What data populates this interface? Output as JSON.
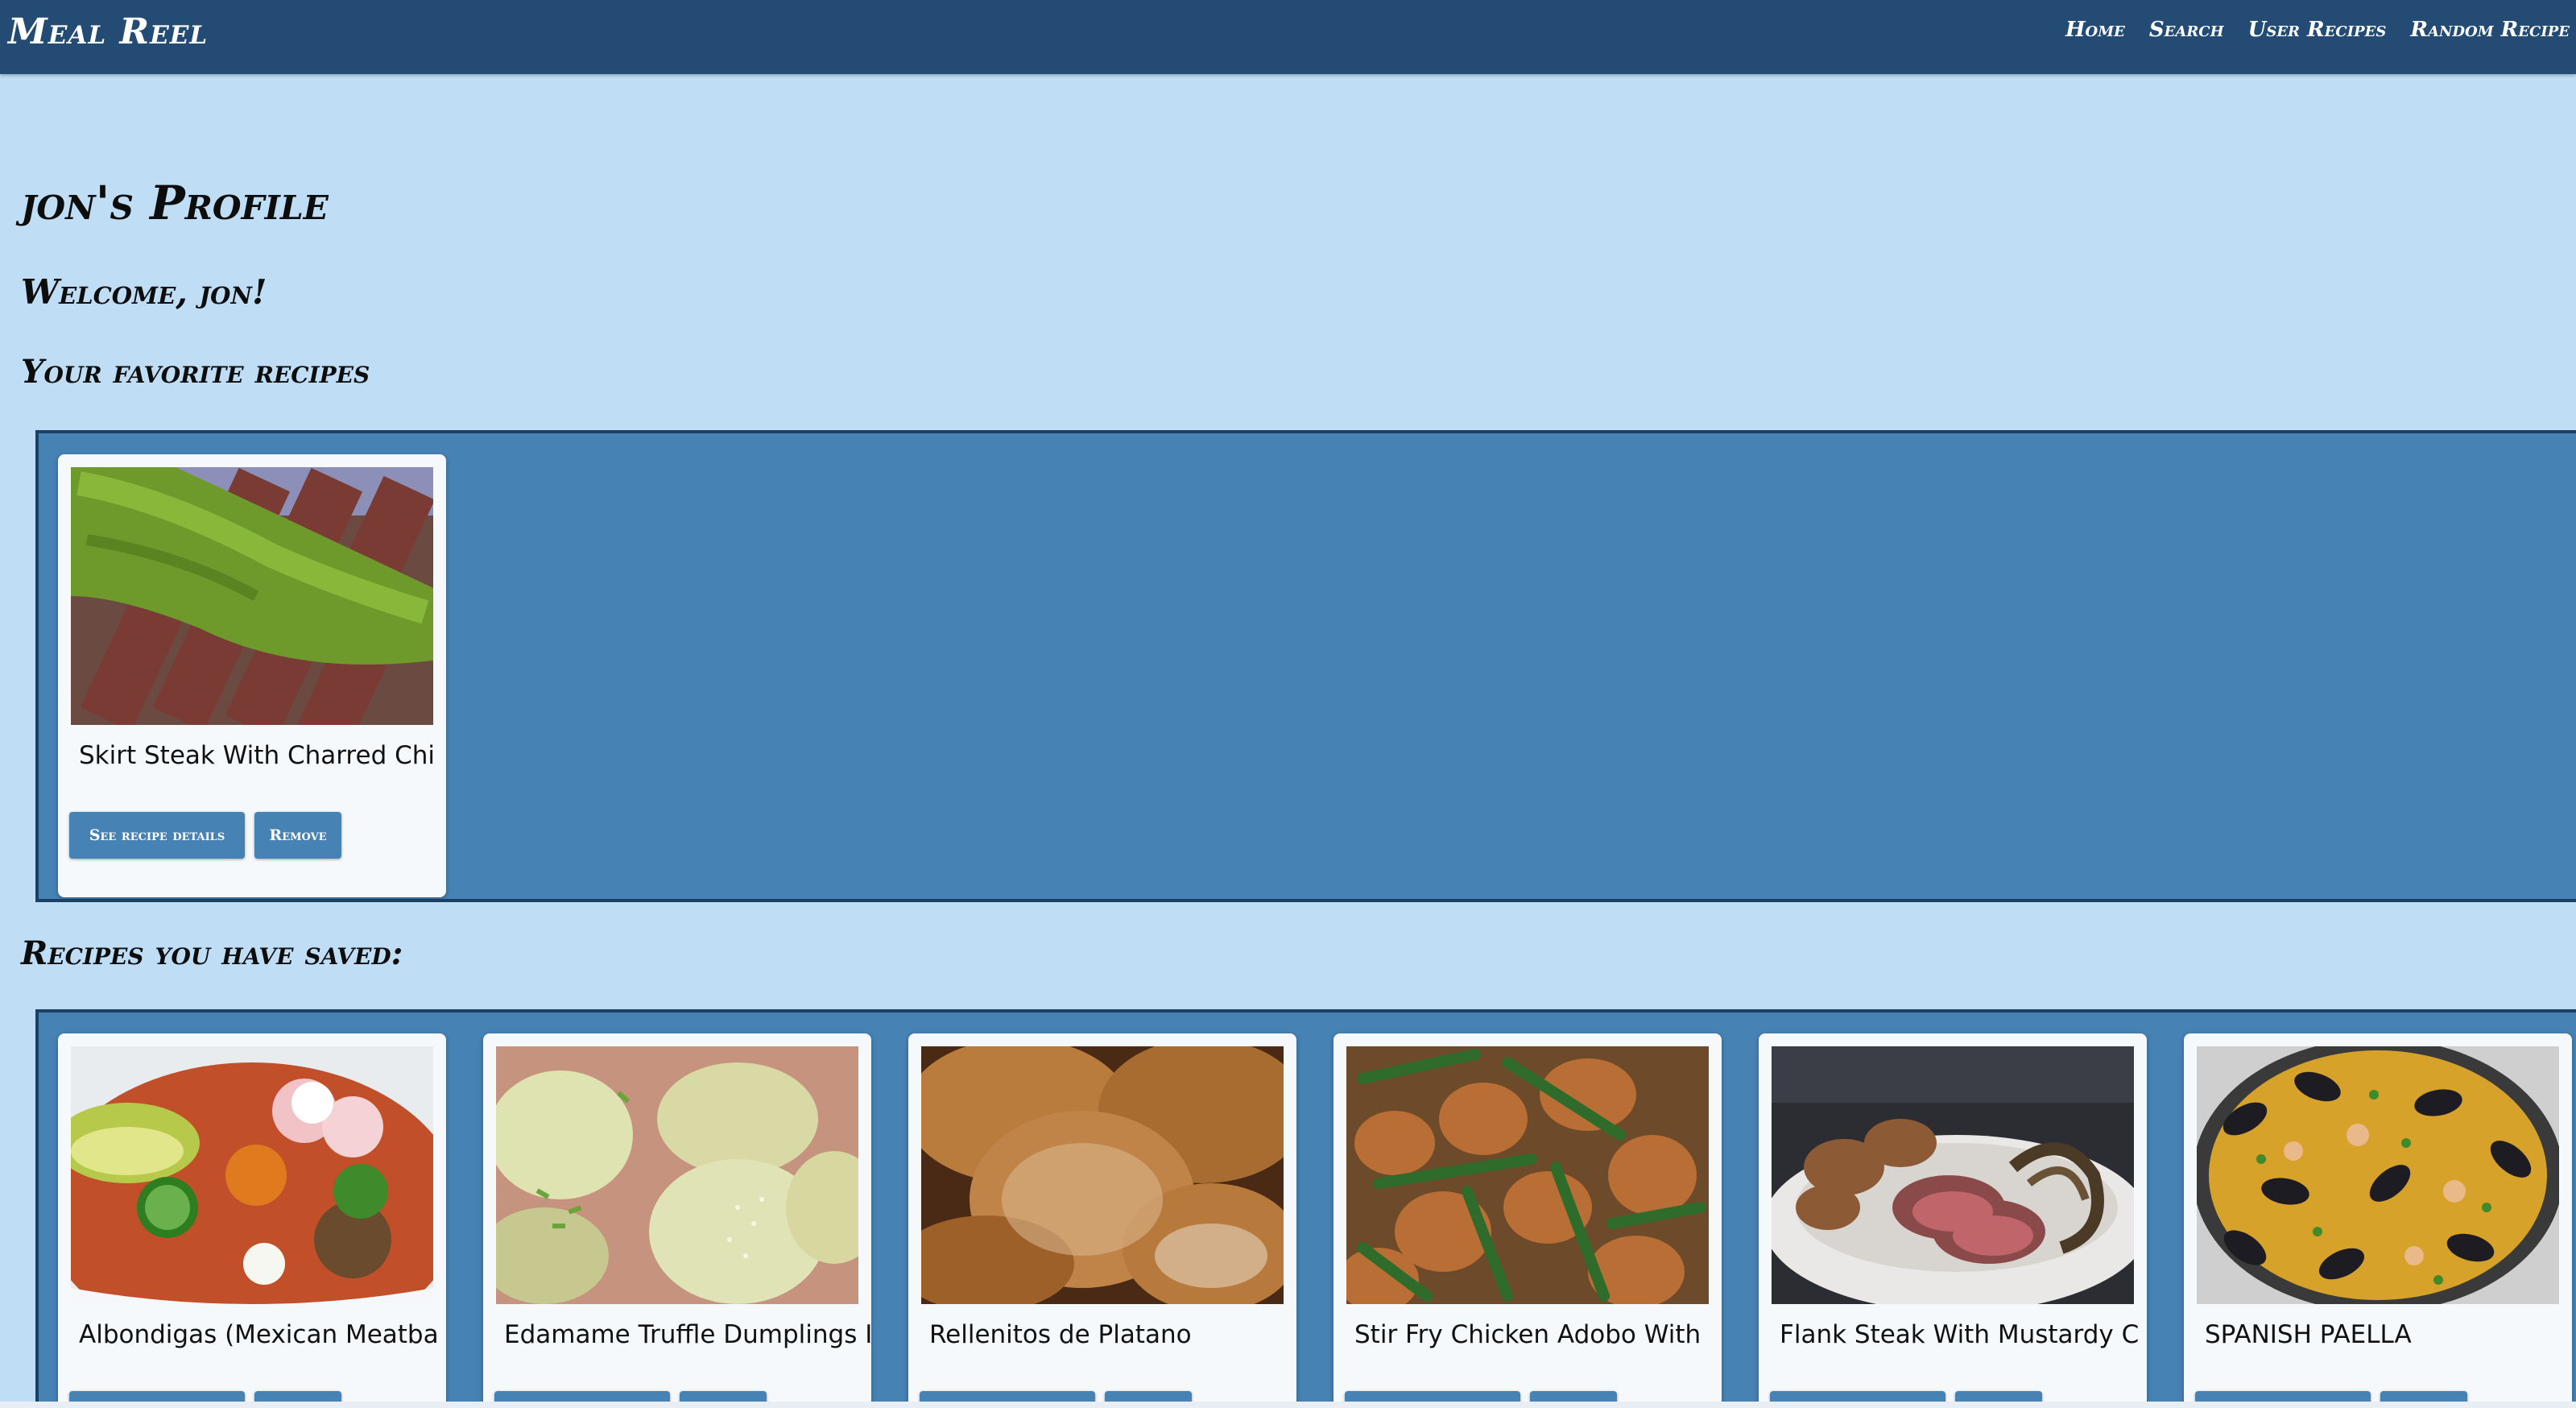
{
  "nav": {
    "brand": "Meal Reel",
    "links": [
      "Home",
      "Search",
      "User Recipes",
      "Random Recipe"
    ]
  },
  "profile": {
    "title": "jon's Profile",
    "welcome": "Welcome, jon!",
    "favorites_heading": "Your favorite recipes",
    "saved_heading": "Recipes you have saved:"
  },
  "buttons": {
    "details": "See recipe details",
    "remove": "Remove"
  },
  "favorites": [
    {
      "title": "Skirt Steak With Charred Chi",
      "image": "steak-chimichurri"
    }
  ],
  "saved": [
    {
      "title": "Albondigas (Mexican Meatba",
      "image": "albondigas-soup"
    },
    {
      "title": "Edamame Truffle Dumplings I",
      "image": "dumplings"
    },
    {
      "title": "Rellenitos de Platano",
      "image": "rellenitos"
    },
    {
      "title": "Stir Fry Chicken Adobo With",
      "image": "chicken-adobo"
    },
    {
      "title": "Flank Steak With Mustardy C",
      "image": "flank-steak"
    },
    {
      "title": "SPANISH PAELLA",
      "image": "paella"
    }
  ],
  "colors": {
    "navbar": "#234b73",
    "page_background": "#bfdef5",
    "panel": "#4682b4",
    "button": "#4682b4"
  }
}
